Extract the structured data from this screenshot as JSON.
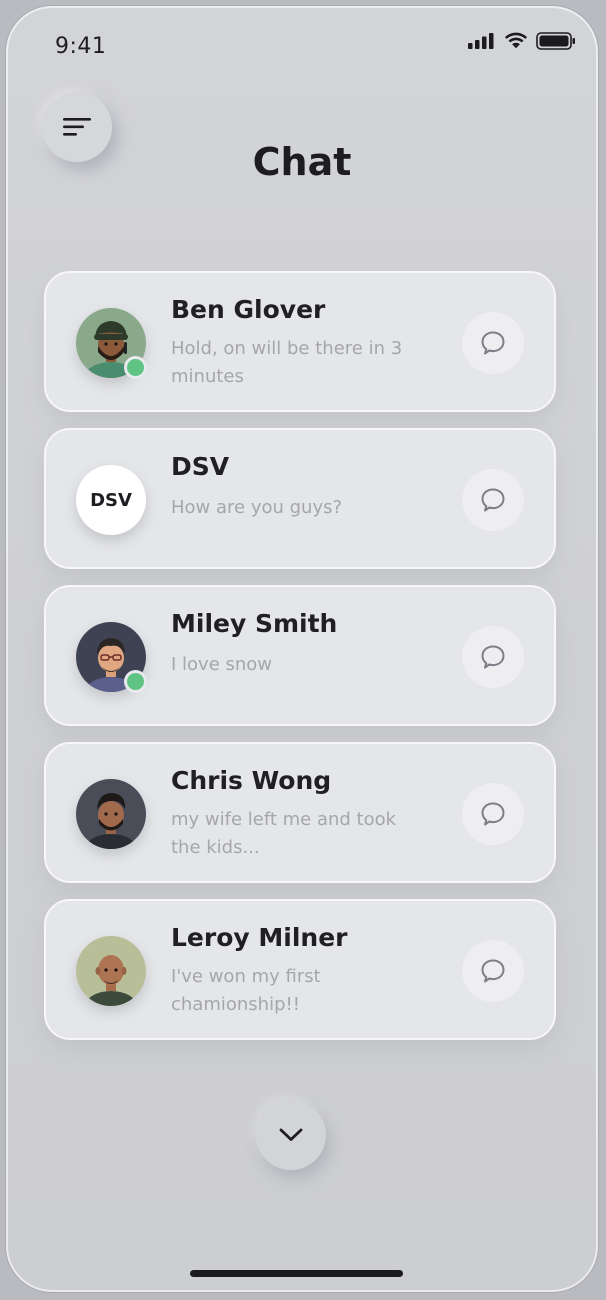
{
  "status_bar": {
    "time": "9:41",
    "icons": [
      "signal-icon",
      "wifi-icon",
      "battery-icon"
    ]
  },
  "header": {
    "title": "Chat",
    "menu_icon": "menu-icon"
  },
  "chats": [
    {
      "name": "Ben Glover",
      "message": "Hold, on will be there in 3 minutes",
      "online": true,
      "avatar": "ben-glover-avatar"
    },
    {
      "name": "DSV",
      "message": "How are you guys?",
      "online": false,
      "avatar_text": "DSV"
    },
    {
      "name": "Miley Smith",
      "message": "I love snow",
      "online": true,
      "avatar": "miley-smith-avatar"
    },
    {
      "name": "Chris Wong",
      "message": "my wife left me and took the kids...",
      "online": false,
      "avatar": "chris-wong-avatar"
    },
    {
      "name": "Leroy Milner",
      "message": "I've won my first chamionship!!",
      "online": false,
      "avatar": "leroy-milner-avatar"
    }
  ],
  "footer": {
    "more_icon": "chevron-down-icon"
  },
  "colors": {
    "background": "#d3d4d8",
    "card": "#e5e6e9",
    "online": "#5fc384",
    "text_primary": "#1f1f24",
    "text_secondary": "#a5a6ac"
  }
}
